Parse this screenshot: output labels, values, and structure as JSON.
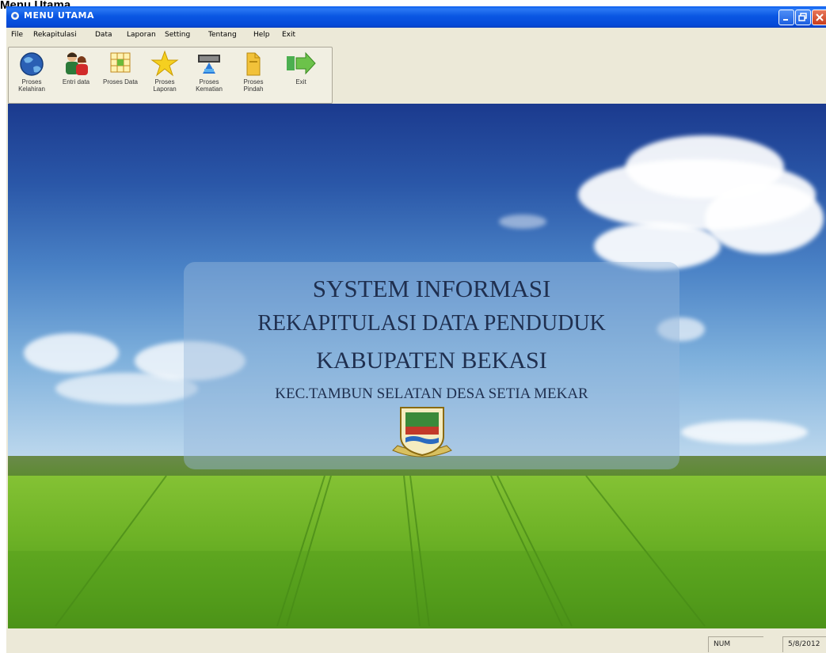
{
  "caption": "Menu Utama",
  "window": {
    "title": "MENU UTAMA",
    "minimize_icon": "minimize-icon",
    "maximize_icon": "maximize-icon",
    "close_icon": "close-icon"
  },
  "menubar": {
    "items": [
      {
        "label": "File"
      },
      {
        "label": "Rekapitulasi"
      },
      {
        "label": "Data"
      },
      {
        "label": "Laporan"
      },
      {
        "label": "Setting"
      },
      {
        "label": "Tentang"
      },
      {
        "label": "Help"
      },
      {
        "label": "Exit"
      }
    ]
  },
  "toolbar": {
    "buttons": [
      {
        "label": "Proses Kelahiran",
        "icon": "globe-icon"
      },
      {
        "label": "Entri data",
        "icon": "people-icon"
      },
      {
        "label": "Proses Data",
        "icon": "table-icon"
      },
      {
        "label": "Proses Laporan",
        "icon": "star-icon"
      },
      {
        "label": "Proses Kematian",
        "icon": "computer-icon"
      },
      {
        "label": "Proses Pindah",
        "icon": "folder-icon"
      },
      {
        "label": "Exit",
        "icon": "exit-arrow-icon"
      }
    ]
  },
  "banner": {
    "line1": "SYSTEM INFORMASI",
    "line2": "REKAPITULASI DATA PENDUDUK",
    "line3": "KABUPATEN BEKASI",
    "line4": "KEC.TAMBUN SELATAN DESA SETIA MEKAR",
    "emblem": "kabupaten-bekasi-emblem"
  },
  "status": {
    "panel1": "NUM",
    "panel2": "5/8/2012"
  },
  "colors": {
    "titlebar": "#0a57e3",
    "chrome": "#ece9d8",
    "banner_text": "#1f2f4f"
  }
}
